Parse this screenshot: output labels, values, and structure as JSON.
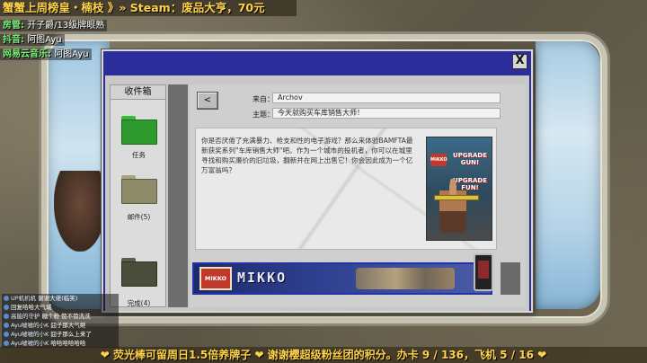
{
  "overlay": {
    "top_banner": "蟹蟹上周榜皇・楠枝 》» Steam：废品大亨，70元",
    "social": [
      {
        "label": "房管:",
        "value": "开子爵/13级牌眼熟"
      },
      {
        "label": "抖音:",
        "value": "阿图Ayu"
      },
      {
        "label": "网易云音乐:",
        "value": "阿图Ayu"
      }
    ],
    "chat": [
      {
        "user": "UP机机机",
        "msg": "谢谢大佬(临笑)"
      },
      {
        "user": "",
        "msg": "回复哈哈大气城"
      },
      {
        "user": "高能的守护",
        "msg": "糖个粉 赞不赞洗洗"
      },
      {
        "user": "Ayu嘘嘘的小K",
        "msg": "囧子那大气继"
      },
      {
        "user": "Ayu嘘嘘的小K",
        "msg": "囧子那么上来了"
      },
      {
        "user": "Ayu嘘嘘的小K",
        "msg": "哈哈哈哈哈哈"
      }
    ],
    "ticker": "❤ 荧光棒可留周日1.5倍养牌子 ❤ 谢谢樱超级粉丝团的积分。办卡 9 / 136，飞机 5 / 16 ❤"
  },
  "window": {
    "close_label": "X",
    "sidebar": {
      "title": "收件箱",
      "folders": [
        {
          "label": "任务",
          "color": "#2e9a2e",
          "tab_color": "#3ab83a"
        },
        {
          "label": "邮件(5)",
          "color": "#8e8c68",
          "tab_color": "#a8a67e"
        },
        {
          "label": "完成(4)",
          "color": "#4a4d3a",
          "tab_color": "#5c5f48"
        }
      ]
    },
    "message": {
      "back_label": "<",
      "from_label": "来自：",
      "from_value": "Archov",
      "subject_label": "主题：",
      "subject_value": "今天就购买车库销售大师！",
      "body": "你是否厌倦了充满暴力、枪支和性的电子游戏？那么来体验BAMFTA最新获奖系列\"车库销售大师\"吧。作为一个城市的投机者，你可以在城里寻找和购买廉价的旧垃圾，翻新并在网上出售它！你会因此成为一个亿万富翁吗？",
      "poster_logo": "MIKKO",
      "poster_line1": "UPGRADE GUN!",
      "poster_line2": "UPGRADE FUN!"
    },
    "ad": {
      "logo": "MIKKO",
      "name": "MIKKO"
    }
  }
}
